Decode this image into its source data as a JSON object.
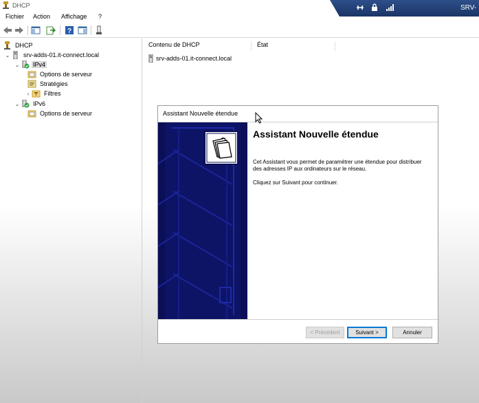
{
  "window": {
    "title": "DHCP"
  },
  "rdp": {
    "server": "SRV-"
  },
  "menu": [
    "Fichier",
    "Action",
    "Affichage",
    "?"
  ],
  "tree": {
    "root": "DHCP",
    "server": "srv-adds-01.it-connect.local",
    "ipv4": "IPv4",
    "ipv4_children": [
      "Options de serveur",
      "Stratégies",
      "Filtres"
    ],
    "ipv6": "IPv6",
    "ipv6_children": [
      "Options de serveur"
    ]
  },
  "content": {
    "columns": [
      "Contenu de DHCP",
      "État"
    ],
    "rows": [
      "srv-adds-01.it-connect.local"
    ]
  },
  "dialog": {
    "title": "Assistant Nouvelle étendue",
    "heading": "Assistant Nouvelle étendue",
    "paragraph1": "Cet Assistant vous permet de paramétrer une étendue pour distribuer des adresses IP aux ordinateurs sur le réseau.",
    "paragraph2": "Cliquez sur Suivant pour continuer.",
    "buttons": {
      "previous": "< Précédent",
      "next": "Suivant >",
      "cancel": "Annuler"
    }
  },
  "colors": {
    "banner": "#0a0f56",
    "rdp_bar": "#2e4f8a",
    "accent": "#0078d7"
  },
  "icons": [
    "dhcp-icon",
    "server-icon",
    "folder-options-icon",
    "policy-icon",
    "filter-icon",
    "pin-icon",
    "lock-icon",
    "signal-icon",
    "back-icon",
    "forward-icon",
    "help-icon",
    "folders-logo-icon",
    "mouse-cursor-icon"
  ]
}
